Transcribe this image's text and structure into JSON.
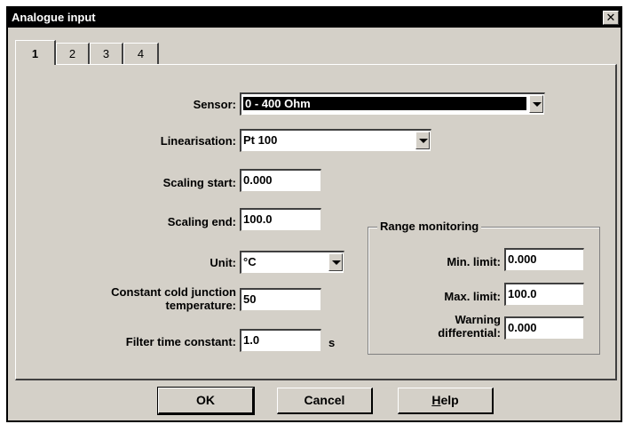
{
  "window": {
    "title": "Analogue input",
    "close_glyph": "✕"
  },
  "tabs": [
    {
      "label": "1",
      "active": true
    },
    {
      "label": "2",
      "active": false
    },
    {
      "label": "3",
      "active": false
    },
    {
      "label": "4",
      "active": false
    }
  ],
  "form": {
    "sensor": {
      "label": "Sensor:",
      "value": "0 - 400 Ohm"
    },
    "linearisation": {
      "label": "Linearisation:",
      "value": "Pt 100"
    },
    "scaling_start": {
      "label": "Scaling start:",
      "value": "0.000"
    },
    "scaling_end": {
      "label": "Scaling end:",
      "value": "100.0"
    },
    "unit": {
      "label": "Unit:",
      "value": "°C"
    },
    "cold_junction": {
      "label_line1": "Constant cold junction",
      "label_line2": "temperature:",
      "value": "50"
    },
    "filter": {
      "label": "Filter time constant:",
      "value": "1.0",
      "unit": "s"
    }
  },
  "range_monitoring": {
    "title": "Range monitoring",
    "min_limit": {
      "label": "Min. limit:",
      "value": "0.000"
    },
    "max_limit": {
      "label": "Max. limit:",
      "value": "100.0"
    },
    "warning": {
      "label_line1": "Warning",
      "label_line2": "differential:",
      "value": "0.000"
    }
  },
  "buttons": {
    "ok": "OK",
    "cancel": "Cancel",
    "help_first": "H",
    "help_rest": "elp"
  }
}
